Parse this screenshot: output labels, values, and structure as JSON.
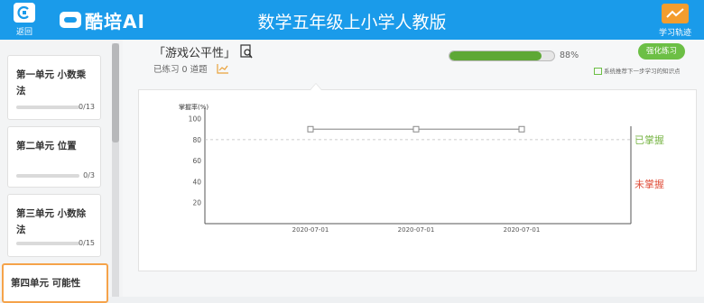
{
  "header": {
    "back_label": "返回",
    "logo_text": "酷培AI",
    "title": "数学五年级上小学人教版",
    "track_label": "学习轨迹",
    "accent": "#1a9bea"
  },
  "sidebar": {
    "units": [
      {
        "title": "第一单元 小数乘法",
        "count": "0/13",
        "progress": 0
      },
      {
        "title": "第二单元 位置",
        "count": "0/3",
        "progress": 0
      },
      {
        "title": "第三单元 小数除法",
        "count": "0/15",
        "progress": 0
      },
      {
        "title": "第四单元 可能性",
        "count": "",
        "progress": 0,
        "active": true
      }
    ]
  },
  "quiz": {
    "title": "「游戏公平性」",
    "practiced": "已练习 0 道题",
    "progress_pct_label": "88%",
    "progress_value": 0.88,
    "strengthen_label": "强化练习",
    "hint": "系统推荐下一步学习的知识点"
  },
  "chart_data": {
    "type": "line",
    "ylabel": "掌握率(%)",
    "yticks": [
      20,
      40,
      60,
      80,
      100
    ],
    "ylim": [
      0,
      110
    ],
    "threshold": 80,
    "x": [
      "2020-07-01",
      "2020-07-01",
      "2020-07-01"
    ],
    "series": [
      {
        "values": [
          90,
          90,
          90
        ]
      }
    ],
    "legend": {
      "mastered": "已掌握",
      "not_mastered": "未掌握"
    },
    "colors": {
      "mastered": "#7ab648",
      "not_mastered": "#e0503c"
    }
  }
}
